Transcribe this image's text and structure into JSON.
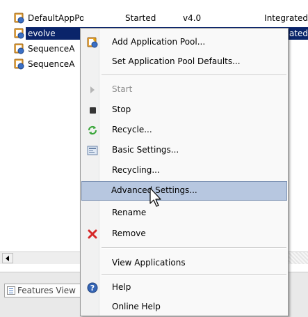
{
  "app_pools": {
    "rows": [
      {
        "name": "DefaultAppPool",
        "status": "Started",
        "version": "v4.0",
        "mode": "Integrated",
        "selected": false
      },
      {
        "name": "evolve",
        "status": "",
        "version": "",
        "mode": "ated",
        "selected": true
      },
      {
        "name": "SequenceA",
        "status": "",
        "version": "",
        "mode": "",
        "selected": false
      },
      {
        "name": "SequenceA",
        "status": "",
        "version": "",
        "mode": "",
        "selected": false
      }
    ],
    "icon": "app-pool-icon"
  },
  "bottom": {
    "features_tab_label": "Features View"
  },
  "context_menu": {
    "items": [
      {
        "label": "Add Application Pool...",
        "icon": "add-app-pool-icon",
        "disabled": false
      },
      {
        "label": "Set Application Pool Defaults...",
        "icon": "",
        "disabled": false
      },
      {
        "label": "Start",
        "icon": "play-icon",
        "disabled": true
      },
      {
        "label": "Stop",
        "icon": "stop-icon",
        "disabled": false
      },
      {
        "label": "Recycle...",
        "icon": "recycle-icon",
        "disabled": false
      },
      {
        "label": "Basic Settings...",
        "icon": "basic-settings-icon",
        "disabled": false
      },
      {
        "label": "Recycling...",
        "icon": "",
        "disabled": false
      },
      {
        "label": "Advanced Settings...",
        "icon": "",
        "disabled": false,
        "hovered": true
      },
      {
        "label": "Rename",
        "icon": "",
        "disabled": false
      },
      {
        "label": "Remove",
        "icon": "remove-x-icon",
        "disabled": false
      },
      {
        "label": "View Applications",
        "icon": "",
        "disabled": false
      },
      {
        "label": "Help",
        "icon": "help-icon",
        "disabled": false
      },
      {
        "label": "Online Help",
        "icon": "",
        "disabled": false
      }
    ]
  },
  "colors": {
    "selection": "#0a246a",
    "menu_hover": "#b7c7e0",
    "remove_icon": "#d62828",
    "recycle_icon": "#3aa63a"
  }
}
